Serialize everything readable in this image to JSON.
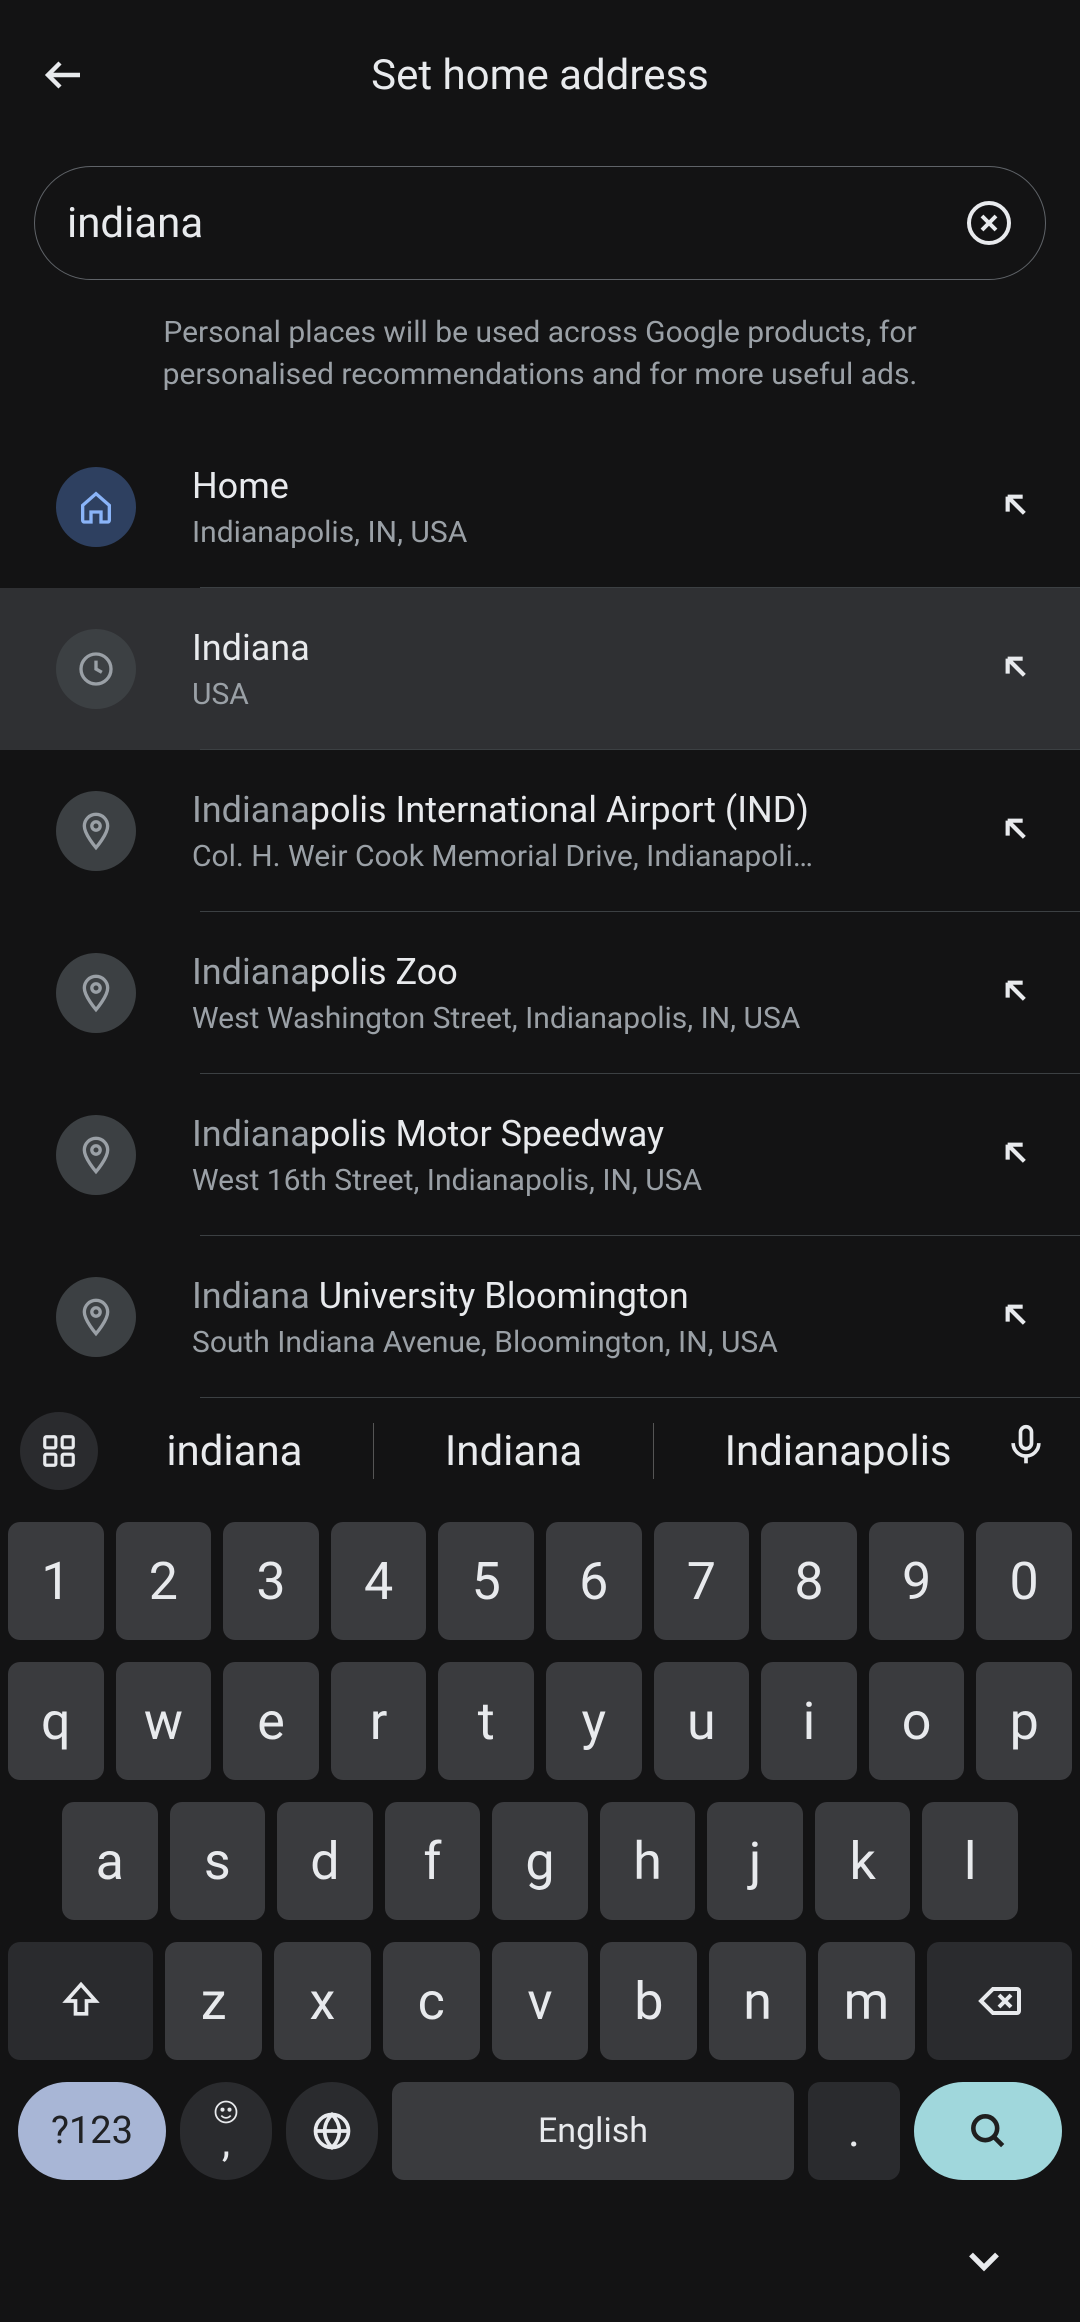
{
  "header": {
    "title": "Set home address"
  },
  "search": {
    "value": "indiana"
  },
  "info": "Personal places will be used across Google products, for personalised recommendations and for more useful ads.",
  "results": [
    {
      "icon": "home",
      "title_match": "",
      "title_rest": "Home",
      "sub": "Indianapolis, IN, USA",
      "active": false
    },
    {
      "icon": "history",
      "title_match": "",
      "title_rest": "Indiana",
      "sub": "USA",
      "active": true
    },
    {
      "icon": "place",
      "title_match": "Indiana",
      "title_rest": "polis International Airport (IND)",
      "sub": "Col. H. Weir Cook Memorial Drive, Indianapoli…",
      "active": false
    },
    {
      "icon": "place",
      "title_match": "Indiana",
      "title_rest": "polis Zoo",
      "sub": "West Washington Street, Indianapolis, IN, USA",
      "active": false
    },
    {
      "icon": "place",
      "title_match": "Indiana",
      "title_rest": "polis Motor Speedway",
      "sub": "West 16th Street, Indianapolis, IN, USA",
      "active": false
    },
    {
      "icon": "place",
      "title_match": "Indiana",
      "title_rest": " University Bloomington",
      "sub": "South Indiana Avenue, Bloomington, IN, USA",
      "active": false
    }
  ],
  "keyboard": {
    "suggestions": [
      "indiana",
      "Indiana",
      "Indianapolis"
    ],
    "row1": [
      "1",
      "2",
      "3",
      "4",
      "5",
      "6",
      "7",
      "8",
      "9",
      "0"
    ],
    "row2": [
      "q",
      "w",
      "e",
      "r",
      "t",
      "y",
      "u",
      "i",
      "o",
      "p"
    ],
    "row3": [
      "a",
      "s",
      "d",
      "f",
      "g",
      "h",
      "j",
      "k",
      "l"
    ],
    "row4": [
      "z",
      "x",
      "c",
      "v",
      "b",
      "n",
      "m"
    ],
    "symkey": "?123",
    "comma": ",",
    "space_label": "English",
    "period": "."
  }
}
